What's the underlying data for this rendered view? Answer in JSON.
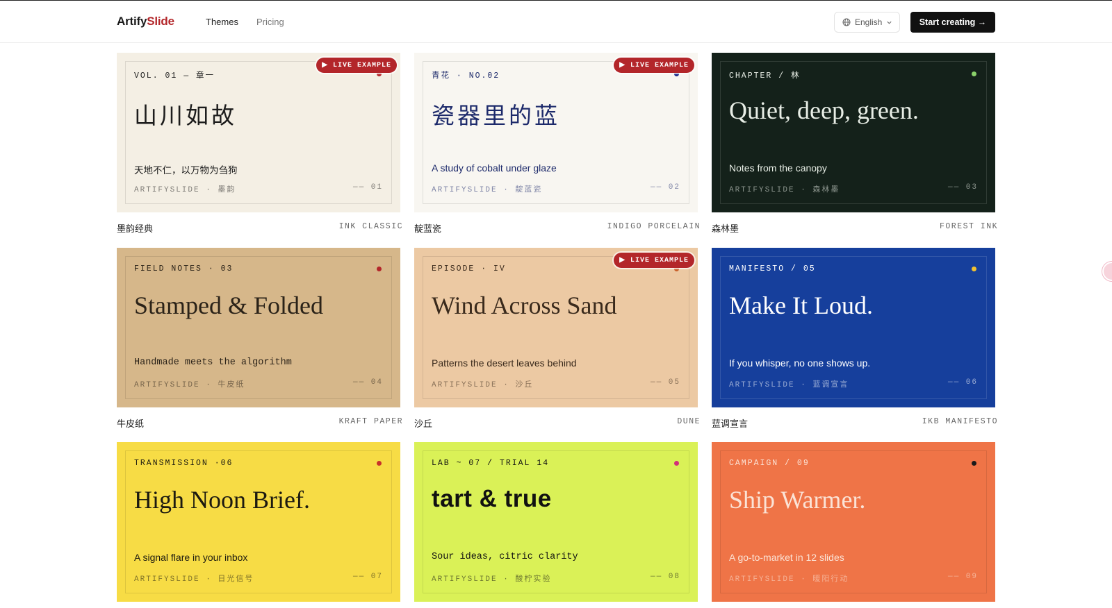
{
  "brand": {
    "name_a": "Artify",
    "name_b": "Slide"
  },
  "nav": {
    "themes": "Themes",
    "pricing": "Pricing"
  },
  "language": {
    "selected": "English"
  },
  "cta": {
    "label": "Start creating →"
  },
  "live_badge": "▶ LIVE EXAMPLE",
  "themes": [
    {
      "kicker": "VOL. 01 — 章一",
      "title": "山川如故",
      "subtitle": "天地不仁，以万物为刍狗",
      "footer_brand": "ARTIFYSLIDE · 墨韵",
      "footer_num": "—— 01",
      "name_cn": "墨韵经典",
      "name_en": "INK CLASSIC",
      "bg": "#f4efe4",
      "fg": "#1c1c1c",
      "dot": "#b3262a",
      "live": true
    },
    {
      "kicker": "青花 · NO.02",
      "title": "瓷器里的蓝",
      "subtitle": "A study of cobalt under glaze",
      "footer_brand": "ARTIFYSLIDE · 靛蓝瓷",
      "footer_num": "—— 02",
      "name_cn": "靛蓝瓷",
      "name_en": "INDIGO PORCELAIN",
      "bg": "#f8f6f1",
      "fg": "#1d2a6b",
      "dot": "#1d2a8b",
      "live": true
    },
    {
      "kicker": "CHAPTER / 林",
      "title": "Quiet, deep, green.",
      "subtitle": "Notes from the canopy",
      "footer_brand": "ARTIFYSLIDE · 森林墨",
      "footer_num": "—— 03",
      "name_cn": "森林墨",
      "name_en": "FOREST INK",
      "bg": "#14211a",
      "fg": "#e8eee6",
      "dot": "#8bd16a",
      "live": false
    },
    {
      "kicker": "FIELD NOTES · 03",
      "title": "Stamped & Folded",
      "subtitle": "Handmade meets the algorithm",
      "footer_brand": "ARTIFYSLIDE · 牛皮纸",
      "footer_num": "—— 04",
      "name_cn": "牛皮纸",
      "name_en": "KRAFT PAPER",
      "bg": "#d6b78a",
      "fg": "#2a2218",
      "dot": "#b3262a",
      "live": false
    },
    {
      "kicker": "EPISODE · IV",
      "title": "Wind Across Sand",
      "subtitle": "Patterns the desert leaves behind",
      "footer_brand": "ARTIFYSLIDE · 沙丘",
      "footer_num": "—— 05",
      "name_cn": "沙丘",
      "name_en": "DUNE",
      "bg": "#ecc9a3",
      "fg": "#3a2a1c",
      "dot": "#c9602a",
      "live": true
    },
    {
      "kicker": "MANIFESTO / 05",
      "title": "Make It Loud.",
      "subtitle": "If you whisper, no one shows up.",
      "footer_brand": "ARTIFYSLIDE · 蓝调宣言",
      "footer_num": "—— 06",
      "name_cn": "蓝调宣言",
      "name_en": "IKB MANIFESTO",
      "bg": "#163f9c",
      "fg": "#ffffff",
      "dot": "#f2c230",
      "live": false
    },
    {
      "kicker": "TRANSMISSION ·06",
      "title": "High Noon Brief.",
      "subtitle": "A signal flare in your inbox",
      "footer_brand": "ARTIFYSLIDE · 日光信号",
      "footer_num": "—— 07",
      "name_cn": "",
      "name_en": "",
      "bg": "#f7dc45",
      "fg": "#1c1a10",
      "dot": "#c8322a",
      "live": false
    },
    {
      "kicker": "LAB ~ 07 / TRIAL 14",
      "title": "tart & true",
      "subtitle": "Sour ideas, citric clarity",
      "footer_brand": "ARTIFYSLIDE · 酸柠实验",
      "footer_num": "—— 08",
      "name_cn": "",
      "name_en": "",
      "bg": "#daf157",
      "fg": "#111111",
      "dot": "#d1307a",
      "live": false
    },
    {
      "kicker": "CAMPAIGN / 09",
      "title": "Ship Warmer.",
      "subtitle": "A go-to-market in 12 slides",
      "footer_brand": "ARTIFYSLIDE · 暖阳行动",
      "footer_num": "—— 09",
      "name_cn": "",
      "name_en": "",
      "bg": "#ef7447",
      "fg": "#fbe3d6",
      "dot": "#1a1a1a",
      "live": false
    }
  ]
}
